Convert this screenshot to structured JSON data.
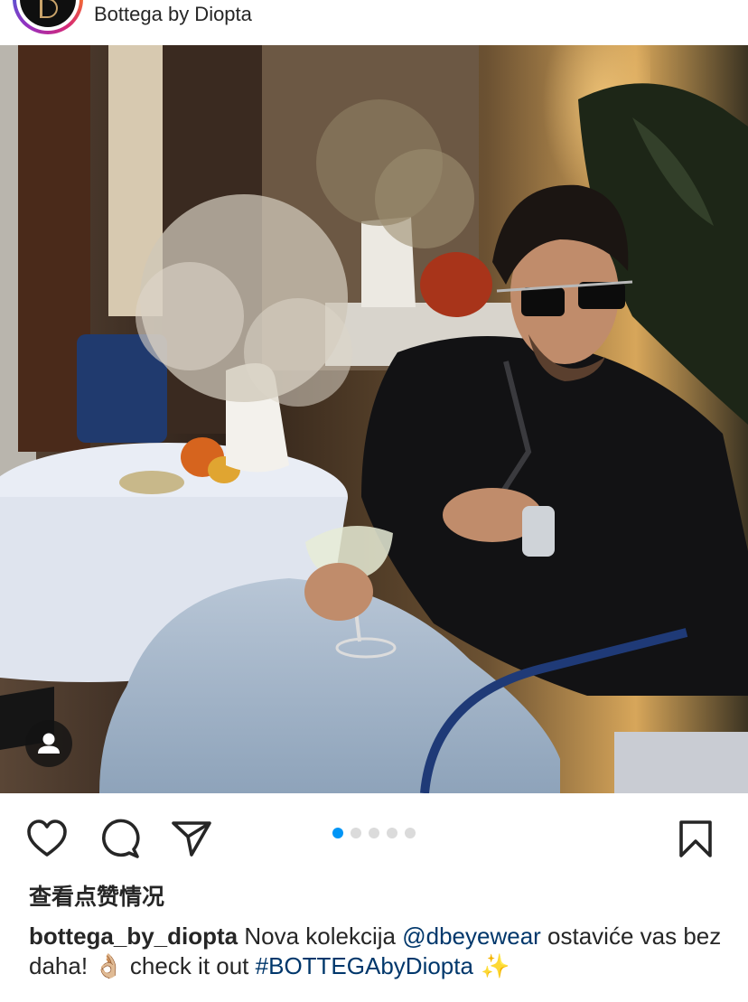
{
  "header": {
    "account_name": "Bottega by Diopta",
    "avatar_icon": "bottega-logo-icon"
  },
  "post": {
    "image_description_icon": "photo-image",
    "user_tag_icon": "person-icon",
    "carousel": {
      "total": 5,
      "current": 1
    }
  },
  "actions": {
    "like_icon": "heart-icon",
    "comment_icon": "comment-bubble-icon",
    "share_icon": "paper-plane-icon",
    "save_icon": "bookmark-icon"
  },
  "likes_label": "查看点赞情况",
  "caption": {
    "username": "bottega_by_diopta",
    "text_1": " Nova kolekcija ",
    "mention": "@dbeyewear",
    "text_2": " ostaviće vas bez daha! ",
    "emoji_1": "👌🏼",
    "text_3": " check it out ",
    "hashtag": "#BOTTEGAbyDiopta",
    "emoji_2": " ✨"
  },
  "colors": {
    "accent": "#0095f6",
    "link": "#00376b",
    "text": "#262626",
    "dot_inactive": "#dbdbdb"
  }
}
